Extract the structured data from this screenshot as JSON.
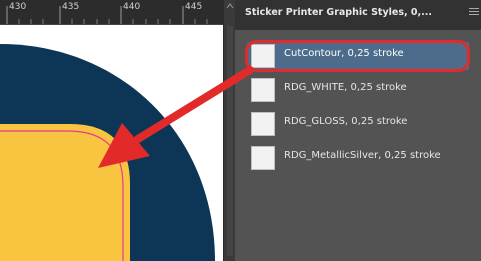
{
  "ruler": {
    "ticks": [
      "430",
      "435",
      "440",
      "445"
    ]
  },
  "panel": {
    "title": "Sticker Printer Graphic Styles, 0,...",
    "styles": [
      {
        "label": "CutContour, 0,25 stroke",
        "selected": true
      },
      {
        "label": "RDG_WHITE, 0,25 stroke",
        "selected": false
      },
      {
        "label": "RDG_GLOSS, 0,25 stroke",
        "selected": false
      },
      {
        "label": "RDG_MetallicSilver, 0,25 stroke",
        "selected": false
      }
    ]
  },
  "colors": {
    "navy_shape": "#0d3656",
    "yellow_shape": "#f9c540",
    "cut_contour_line": "#e6388f",
    "annotation_red": "#e32a2a",
    "selection": "#4d6c8c",
    "panel_bg": "#535353"
  },
  "icons": [
    "panel-menu-icon",
    "scroll-up-arrow-icon",
    "annotation-arrow-icon"
  ]
}
